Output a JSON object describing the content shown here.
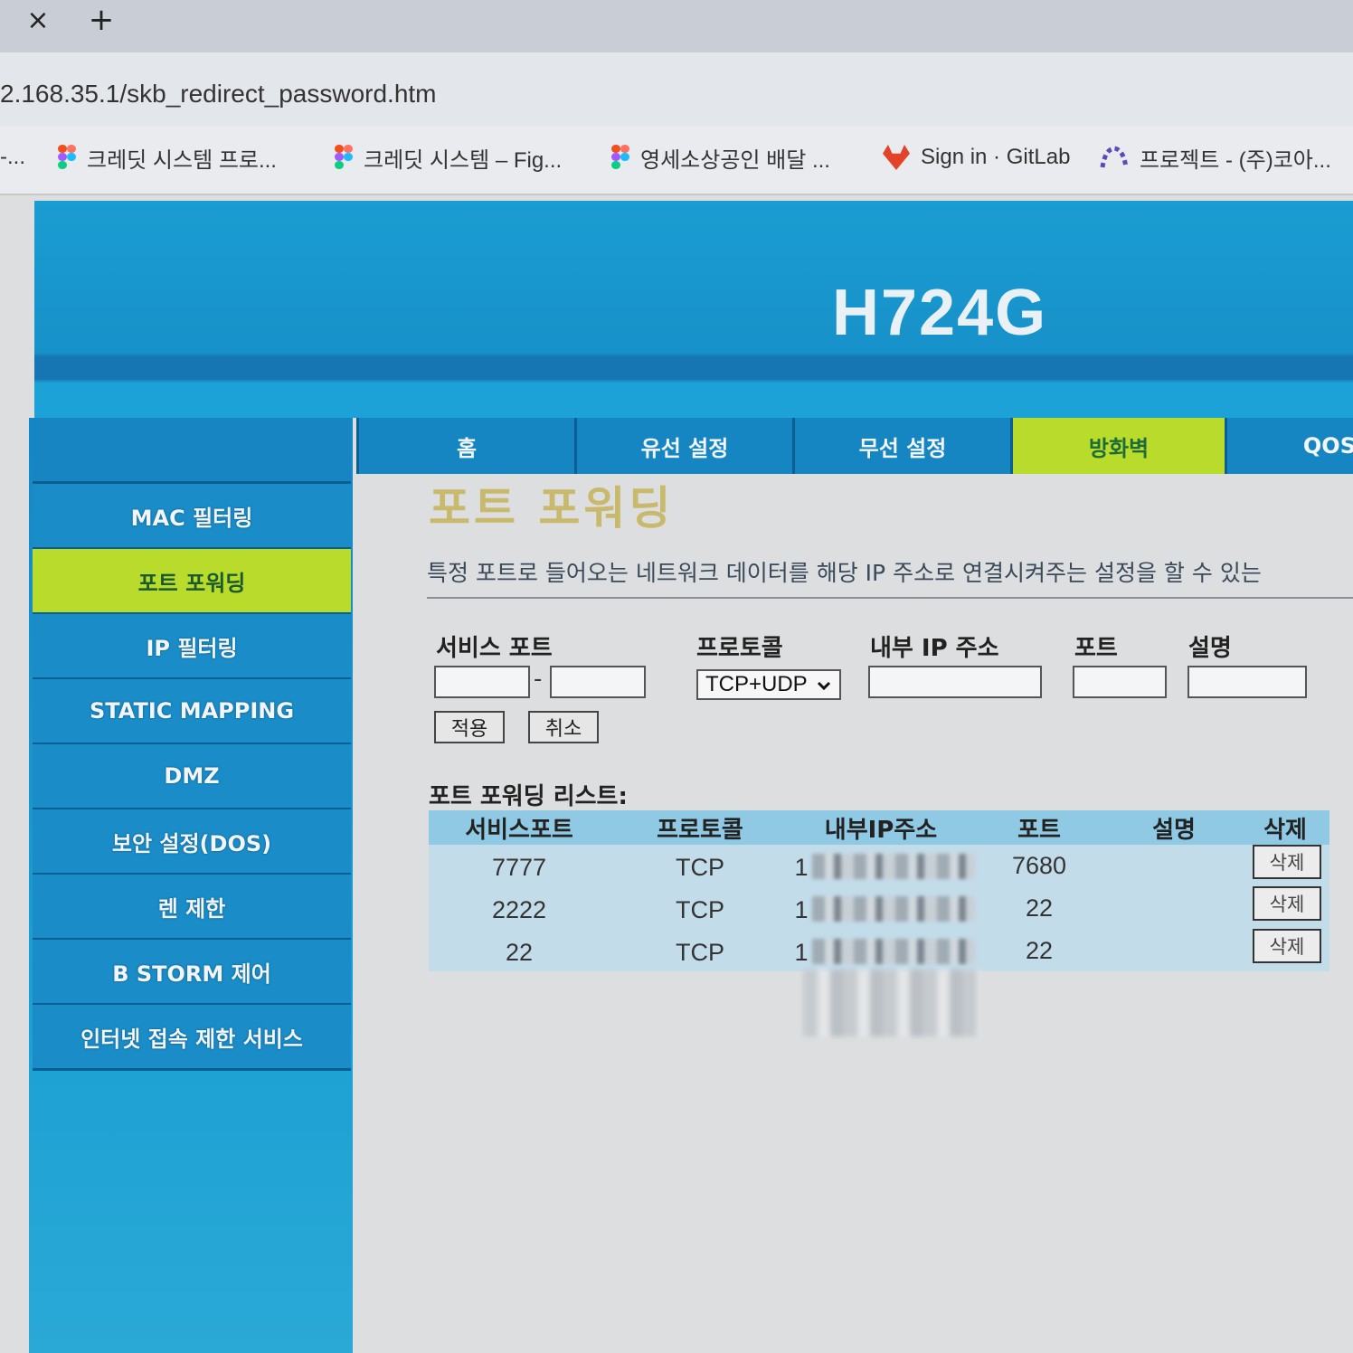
{
  "browser": {
    "tab_close": "×",
    "tab_new": "+",
    "url": "2.168.35.1/skb_redirect_password.htm",
    "bookmarks": [
      {
        "label": "-...",
        "icon": "none"
      },
      {
        "label": "크레딧 시스템 프로...",
        "icon": "figma-icon"
      },
      {
        "label": "크레딧 시스템 – Fig...",
        "icon": "figma-icon"
      },
      {
        "label": "영세소상공인 배달 ...",
        "icon": "figma-icon"
      },
      {
        "label": "Sign in · GitLab",
        "icon": "gitlab-icon"
      },
      {
        "label": "프로젝트 - (주)코아...",
        "icon": "project-icon"
      }
    ]
  },
  "router": {
    "model": "H724G",
    "nav": [
      "홈",
      "유선 설정",
      "무선 설정",
      "방화벽",
      "QOS"
    ],
    "nav_active": "방화벽",
    "sidebar": [
      "MAC 필터링",
      "포트 포워딩",
      "IP 필터링",
      "STATIC MAPPING",
      "DMZ",
      "보안 설정(DOS)",
      "렌 제한",
      "B STORM 제어",
      "인터넷 접속 제한 서비스"
    ],
    "sidebar_active": "포트 포워딩",
    "page_title": "포트 포워딩",
    "description": "특정 포트로 들어오는 네트워크 데이터를 해당 IP 주소로 연결시켜주는 설정을 할 수 있는",
    "form": {
      "labels": {
        "service_port": "서비스 포트",
        "protocol": "프로토콜",
        "internal_ip": "내부 IP 주소",
        "port": "포트",
        "description": "설명"
      },
      "port_separator": "-",
      "protocol_selected": "TCP+UDP",
      "apply": "적용",
      "cancel": "취소"
    },
    "list": {
      "title": "포트 포워딩 리스트:",
      "headers": [
        "서비스포트",
        "프로토콜",
        "내부IP주소",
        "포트",
        "설명",
        "삭제"
      ],
      "rows": [
        {
          "service_port": "7777",
          "protocol": "TCP",
          "ip": "1",
          "port": "7680",
          "desc": "",
          "delete": "삭제"
        },
        {
          "service_port": "2222",
          "protocol": "TCP",
          "ip": "1",
          "port": "22",
          "desc": "",
          "delete": "삭제"
        },
        {
          "service_port": "22",
          "protocol": "TCP",
          "ip": "1",
          "port": "22",
          "desc": "",
          "delete": "삭제"
        }
      ]
    }
  },
  "colors": {
    "accent_green": "#b9dc2c",
    "nav_blue": "#1686c3",
    "title_gold": "#c8b96c"
  }
}
